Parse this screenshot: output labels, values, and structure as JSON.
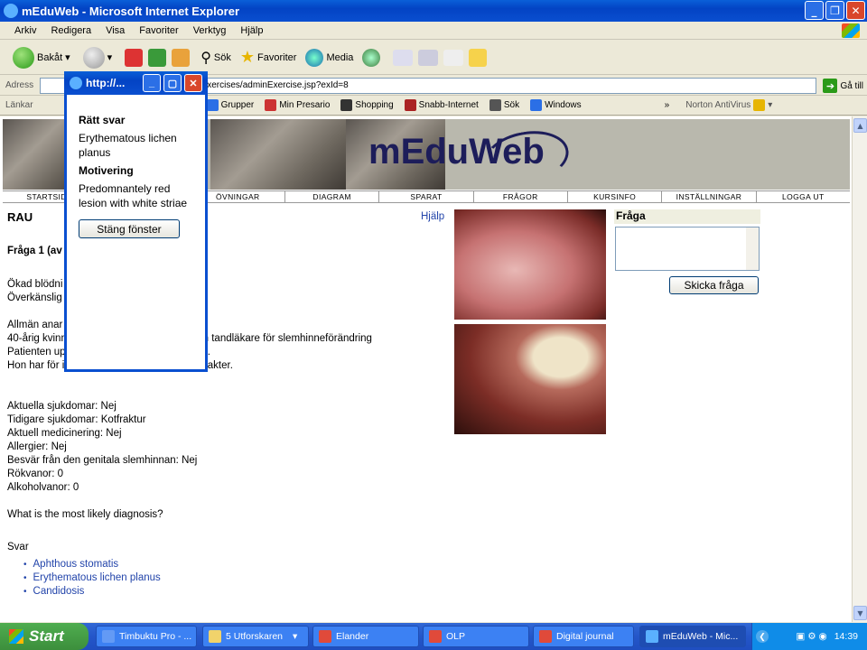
{
  "window": {
    "title": "mEduWeb - Microsoft Internet Explorer"
  },
  "menu": [
    "Arkiv",
    "Redigera",
    "Visa",
    "Favoriter",
    "Verktyg",
    "Hjälp"
  ],
  "toolbar": {
    "back": "Bakåt",
    "search": "Sök",
    "favorites": "Favoriter",
    "media": "Media"
  },
  "address": {
    "label": "Adress",
    "url": "ent/exercises/adminExercise.jsp?exId=8",
    "go": "Gå till"
  },
  "links": {
    "label": "Länkar",
    "items": [
      "Grupper",
      "Min Presario",
      "Shopping",
      "Snabb-Internet",
      "Sök",
      "Windows"
    ],
    "norton": "Norton AntiVirus"
  },
  "site": {
    "logo": "mEduWeb",
    "nav": [
      "STARTSIDA",
      "",
      "ÖVNINGAR",
      "DIAGRAM",
      "SPARAT",
      "FRÅGOR",
      "KURSINFO",
      "INSTÄLLNINGAR",
      "LOGGA UT"
    ],
    "title": "RAU",
    "help": "Hjälp",
    "question_label": "Fråga 1 (av",
    "case_lines": [
      "Ökad blödni",
      "Överkänslig",
      "",
      "Allmän anar",
      "40-årig kvinn                                    rats från tandläkare för slemhinneförändring",
      "Patienten up                                    fullt frisk.",
      "Hon har för i                                   läkarkontakter.",
      "",
      "",
      "Aktuella sjukdomar: Nej",
      "Tidigare sjukdomar: Kotfraktur",
      "Aktuell medicinering: Nej",
      "Allergier: Nej",
      "Besvär från den genitala slemhinnan: Nej",
      "Rökvanor: 0",
      "Alkoholvanor: 0",
      "",
      "What is the most likely diagnosis?"
    ],
    "answers_label": "Svar",
    "answers": [
      "Aphthous stomatis",
      "Erythematous lichen planus",
      "Candidosis"
    ],
    "fraga_label": "Fråga",
    "send_button": "Skicka fråga"
  },
  "popup": {
    "title": "http://...",
    "correct_label": "Rätt svar",
    "correct_answer": "Erythematous lichen planus",
    "motivation_label": "Motivering",
    "motivation": "Predomnantely red lesion with white striae",
    "close_button": "Stäng fönster"
  },
  "taskbar": {
    "start": "Start",
    "tasks": [
      "Timbuktu Pro - ...",
      "5 Utforskaren",
      "Elander",
      "OLP",
      "Digital journal",
      "mEduWeb - Mic..."
    ],
    "clock": "14:39"
  }
}
